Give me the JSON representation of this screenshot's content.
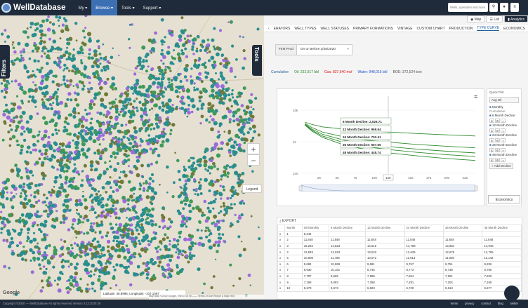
{
  "app": {
    "brand": "WellDatabase"
  },
  "nav": {
    "my": "My ▾",
    "browse": "Browse ▾",
    "tools": "Tools ▾",
    "support": "Support ▾",
    "search_placeholder": "Wells, operators and more"
  },
  "map": {
    "filters_label": "Filters",
    "tools_label": "Tools",
    "zoom_in": "+",
    "zoom_out": "−",
    "legend": "Legend",
    "latlng": "Latitude: 36.8996, Longitude: -107.1097",
    "footer": "Map data ©2020 Google, INEGI   10 mi ——   Terms of Use   Report a map error",
    "google": "Google",
    "colors": {
      "teal": "#2a8e8f",
      "purple": "#9b6bd9",
      "olive": "#6f7a3a",
      "green": "#3f9a58"
    }
  },
  "view_buttons": {
    "map": "Map",
    "list": "List",
    "analytics": "Analytics"
  },
  "tabs": [
    "ERATORS",
    "WELL TYPES",
    "WELL STATUSES",
    "PRIMARY FORMATIONS",
    "VINTAGE",
    "CUSTOM CHART",
    "PRODUCTION",
    "TYPE CURVE",
    "ECONOMICS"
  ],
  "first_prod": {
    "label": "First Prod",
    "value": "On or Before 3/26/2020",
    "clear": "×"
  },
  "cumulative": {
    "label": "Cumulative",
    "oil": "Oil: 232,917 bbl",
    "gas": "Gas: 837,640 mcf",
    "water": "Water: 948,016 bbl",
    "boe": "BOE: 372,524 boe",
    "oil_color": "#2e8b2e",
    "gas_color": "#d11",
    "water_color": "#1f4fd0"
  },
  "chart_data": {
    "type": "line",
    "xlabel": "",
    "ylabel": "",
    "ylog": true,
    "yticks": [
      "10k",
      "1k",
      "100"
    ],
    "ylim": [
      100,
      10000
    ],
    "xticks": [
      25,
      50,
      75,
      100,
      120,
      150,
      175,
      200,
      225
    ],
    "xlim": [
      0,
      240
    ],
    "cursor_x": 120,
    "series": [
      {
        "name": "6 Month Decline",
        "label": "6 Month Decline: 2,026.71",
        "values": [
          {
            "x": 5,
            "y": 4200
          },
          {
            "x": 15,
            "y": 3500
          },
          {
            "x": 30,
            "y": 2950
          },
          {
            "x": 60,
            "y": 2500
          },
          {
            "x": 90,
            "y": 2250
          },
          {
            "x": 120,
            "y": 2026.71
          },
          {
            "x": 160,
            "y": 1820
          },
          {
            "x": 200,
            "y": 1650
          },
          {
            "x": 240,
            "y": 1520
          }
        ]
      },
      {
        "name": "12 Month Decline",
        "label": "12 Month Decline: 969.54",
        "values": [
          {
            "x": 5,
            "y": 3800
          },
          {
            "x": 15,
            "y": 2800
          },
          {
            "x": 30,
            "y": 2000
          },
          {
            "x": 60,
            "y": 1400
          },
          {
            "x": 90,
            "y": 1120
          },
          {
            "x": 120,
            "y": 969.54
          },
          {
            "x": 160,
            "y": 820
          },
          {
            "x": 200,
            "y": 720
          },
          {
            "x": 240,
            "y": 640
          }
        ]
      },
      {
        "name": "24 Month Decline",
        "label": "24 Month Decline: 702.41",
        "values": [
          {
            "x": 5,
            "y": 3600
          },
          {
            "x": 15,
            "y": 2500
          },
          {
            "x": 30,
            "y": 1700
          },
          {
            "x": 60,
            "y": 1100
          },
          {
            "x": 90,
            "y": 850
          },
          {
            "x": 120,
            "y": 702.41
          },
          {
            "x": 160,
            "y": 580
          },
          {
            "x": 200,
            "y": 500
          },
          {
            "x": 240,
            "y": 440
          }
        ]
      },
      {
        "name": "36 Month Decline",
        "label": "36 Month Decline: 567.55",
        "values": [
          {
            "x": 5,
            "y": 3500
          },
          {
            "x": 15,
            "y": 2300
          },
          {
            "x": 30,
            "y": 1500
          },
          {
            "x": 60,
            "y": 920
          },
          {
            "x": 90,
            "y": 700
          },
          {
            "x": 120,
            "y": 567.55
          },
          {
            "x": 160,
            "y": 460
          },
          {
            "x": 200,
            "y": 390
          },
          {
            "x": 240,
            "y": 340
          }
        ]
      },
      {
        "name": "48 Month Decline",
        "label": "48 Month Decline: 445.74",
        "values": [
          {
            "x": 5,
            "y": 3400
          },
          {
            "x": 15,
            "y": 2150
          },
          {
            "x": 30,
            "y": 1350
          },
          {
            "x": 60,
            "y": 780
          },
          {
            "x": 90,
            "y": 570
          },
          {
            "x": 120,
            "y": 445.74
          },
          {
            "x": 160,
            "y": 355
          },
          {
            "x": 200,
            "y": 295
          },
          {
            "x": 240,
            "y": 255
          }
        ]
      }
    ],
    "line_color": "#2e8b2e"
  },
  "quick_plot": {
    "title": "Quick Plot",
    "product": "Avg Oil",
    "monthly": "Monthly",
    "cumulative": "Cumulative",
    "items": [
      "6 Month Decline",
      "12 Month Decline",
      "24 Month Decline",
      "36 Month Decline",
      "48 Month Decline"
    ],
    "add": "+ Add Decline",
    "economics": "Economics"
  },
  "table": {
    "export": "EXPORT",
    "headers": [
      "",
      "Month",
      "Oil Monthly",
      "6 Month Decline",
      "12 Month Decline",
      "24 Month Decline",
      "36 Month Decline",
      "48 Month Decline"
    ],
    "rows": [
      [
        "x",
        "1",
        "8,344",
        "",
        "",
        "",
        "",
        ""
      ],
      [
        "x",
        "2",
        "11,848",
        "11,848",
        "11,848",
        "11,848",
        "11,848",
        "11,848"
      ],
      [
        "x",
        "3",
        "15,294",
        "14,823",
        "14,616",
        "14,788",
        "14,864",
        "14,945"
      ],
      [
        "x",
        "4",
        "13,945",
        "13,023",
        "13,043",
        "12,625",
        "12,675",
        "12,765"
      ],
      [
        "x",
        "5",
        "10,808",
        "11,785",
        "10,072",
        "11,013",
        "11,038",
        "11,142"
      ],
      [
        "x",
        "6",
        "9,684",
        "10,868",
        "9,681",
        "9,767",
        "9,751",
        "9,836"
      ],
      [
        "x",
        "7",
        "8,930",
        "10,151",
        "8,746",
        "8,773",
        "8,738",
        "8,780"
      ],
      [
        "x",
        "8",
        "7,797",
        "9,569",
        "7,985",
        "7,964",
        "7,901",
        "7,920"
      ],
      [
        "x",
        "9",
        "7,168",
        "9,083",
        "7,358",
        "7,291",
        "7,204",
        "7,196"
      ],
      [
        "x",
        "10",
        "6,279",
        "8,673",
        "6,823",
        "6,720",
        "6,613",
        "6,577"
      ]
    ]
  },
  "footer": {
    "copyright": "Copyright ©2020  — WellDatabase  All rights reserved  Version 3.12.2020.29",
    "links": [
      "terms",
      "privacy",
      "contact",
      "blog",
      "twitter"
    ]
  }
}
